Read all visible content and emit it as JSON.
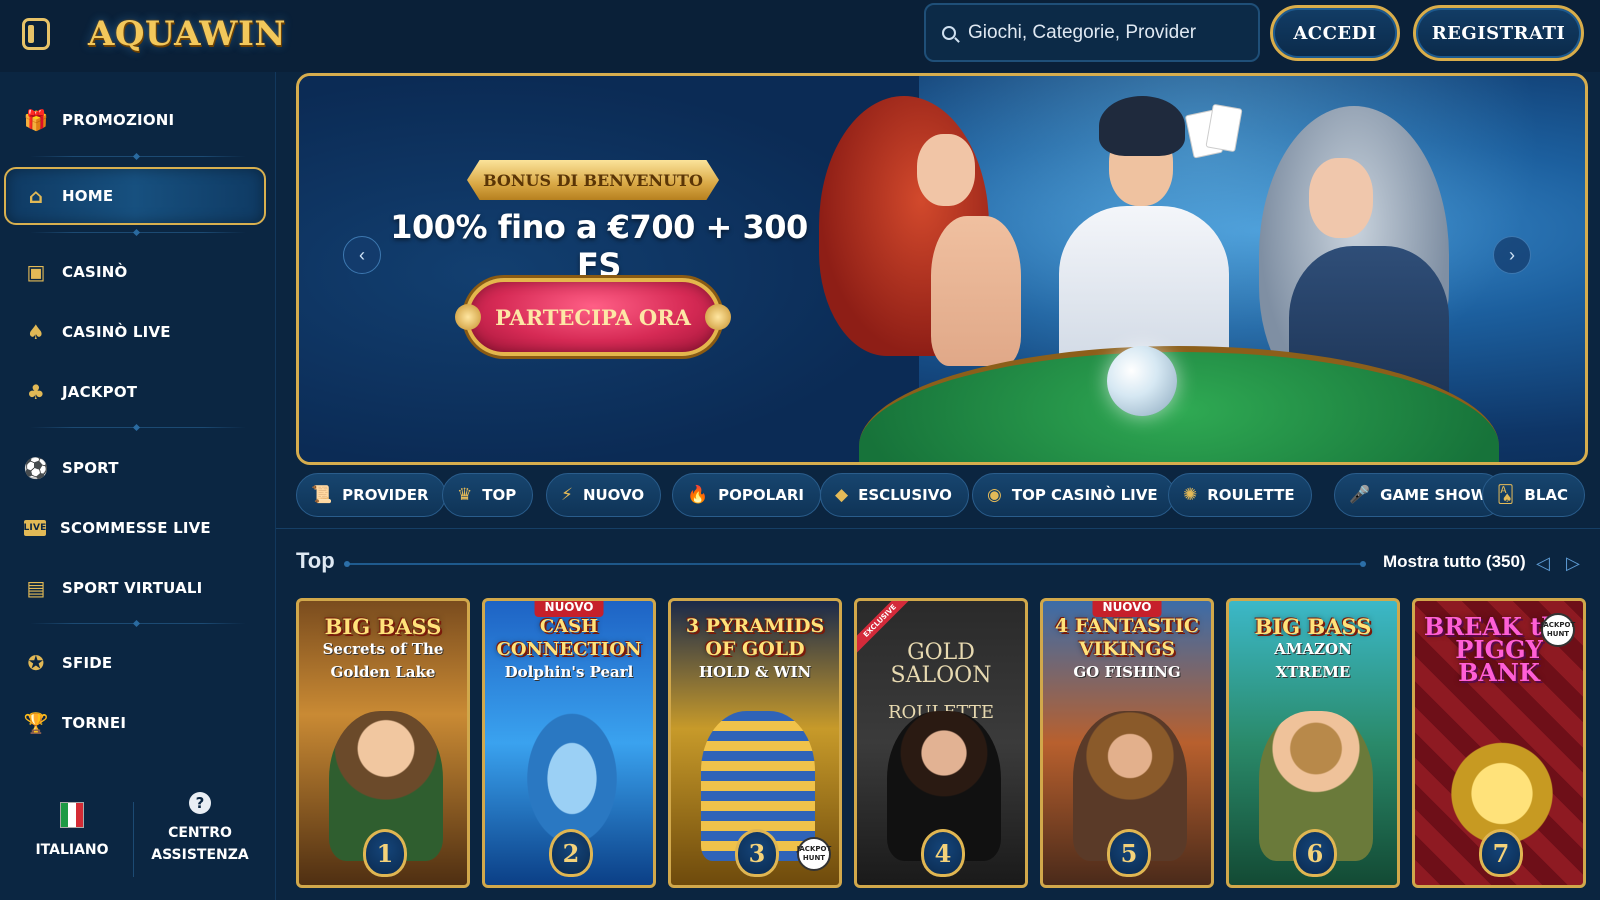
{
  "header": {
    "logo_text": "AQUAWIN",
    "search_placeholder": "Giochi, Categorie, Provider",
    "login_label": "ACCEDI",
    "register_label": "REGISTRATI"
  },
  "sidebar": {
    "items": [
      {
        "label": "PROMOZIONI",
        "icon": "gift-icon"
      },
      {
        "label": "HOME",
        "icon": "home-icon",
        "active": true
      },
      {
        "label": "CASINÒ",
        "icon": "slot-machine-icon"
      },
      {
        "label": "CASINÒ LIVE",
        "icon": "live-card-icon"
      },
      {
        "label": "JACKPOT",
        "icon": "clover-icon"
      },
      {
        "label": "SPORT",
        "icon": "soccer-ball-icon"
      },
      {
        "label": "SCOMMESSE LIVE",
        "icon": "live-badge-icon"
      },
      {
        "label": "SPORT VIRTUALI",
        "icon": "virtual-sport-icon"
      },
      {
        "label": "SFIDE",
        "icon": "medal-icon"
      },
      {
        "label": "TORNEI",
        "icon": "trophy-icon"
      }
    ],
    "language_label": "ITALIANO",
    "help_label_line1": "CENTRO",
    "help_label_line2": "ASSISTENZA",
    "help_icon": "?"
  },
  "banner": {
    "ribbon": "BONUS DI BENVENUTO",
    "headline": "100% fino a €700 + 300 FS",
    "cta": "PARTECIPA ORA"
  },
  "categories": [
    {
      "label": "PROVIDER",
      "icon": "scroll-icon"
    },
    {
      "label": "TOP",
      "icon": "crown-icon"
    },
    {
      "label": "NUOVO",
      "icon": "lightning-icon"
    },
    {
      "label": "POPOLARI",
      "icon": "torch-icon"
    },
    {
      "label": "ESCLUSIVO",
      "icon": "diamond-icon"
    },
    {
      "label": "TOP CASINÒ LIVE",
      "icon": "chip-icon"
    },
    {
      "label": "ROULETTE",
      "icon": "roulette-icon"
    },
    {
      "label": "GAME SHOW",
      "icon": "microphone-icon"
    },
    {
      "label": "BLAC",
      "icon": "cards-icon"
    }
  ],
  "top_section": {
    "title": "Top",
    "show_all": "Mostra tutto (350)"
  },
  "games": [
    {
      "rank": "1",
      "title": "BIG BASS",
      "subtitle": "Secrets of The Golden Lake",
      "badge": ""
    },
    {
      "rank": "2",
      "title": "CASH CONNECTION",
      "subtitle": "Dolphin's Pearl",
      "badge": "NUOVO"
    },
    {
      "rank": "3",
      "title": "3 PYRAMIDS OF GOLD",
      "subtitle": "HOLD & WIN",
      "badge": "",
      "stamp": "JACKPOT HUNT"
    },
    {
      "rank": "4",
      "title": "GOLD SALOON",
      "subtitle": "ROULETTE",
      "badge": "EXCLUSIVE"
    },
    {
      "rank": "5",
      "title": "4 FANTASTIC VIKINGS",
      "subtitle": "GO FISHING",
      "badge": "NUOVO"
    },
    {
      "rank": "6",
      "title": "BIG BASS",
      "subtitle": "AMAZON XTREME",
      "badge": ""
    },
    {
      "rank": "7",
      "title": "BREAK the PIGGY BANK",
      "subtitle": "",
      "badge": "",
      "stamp": "JACKPOT HUNT"
    }
  ]
}
